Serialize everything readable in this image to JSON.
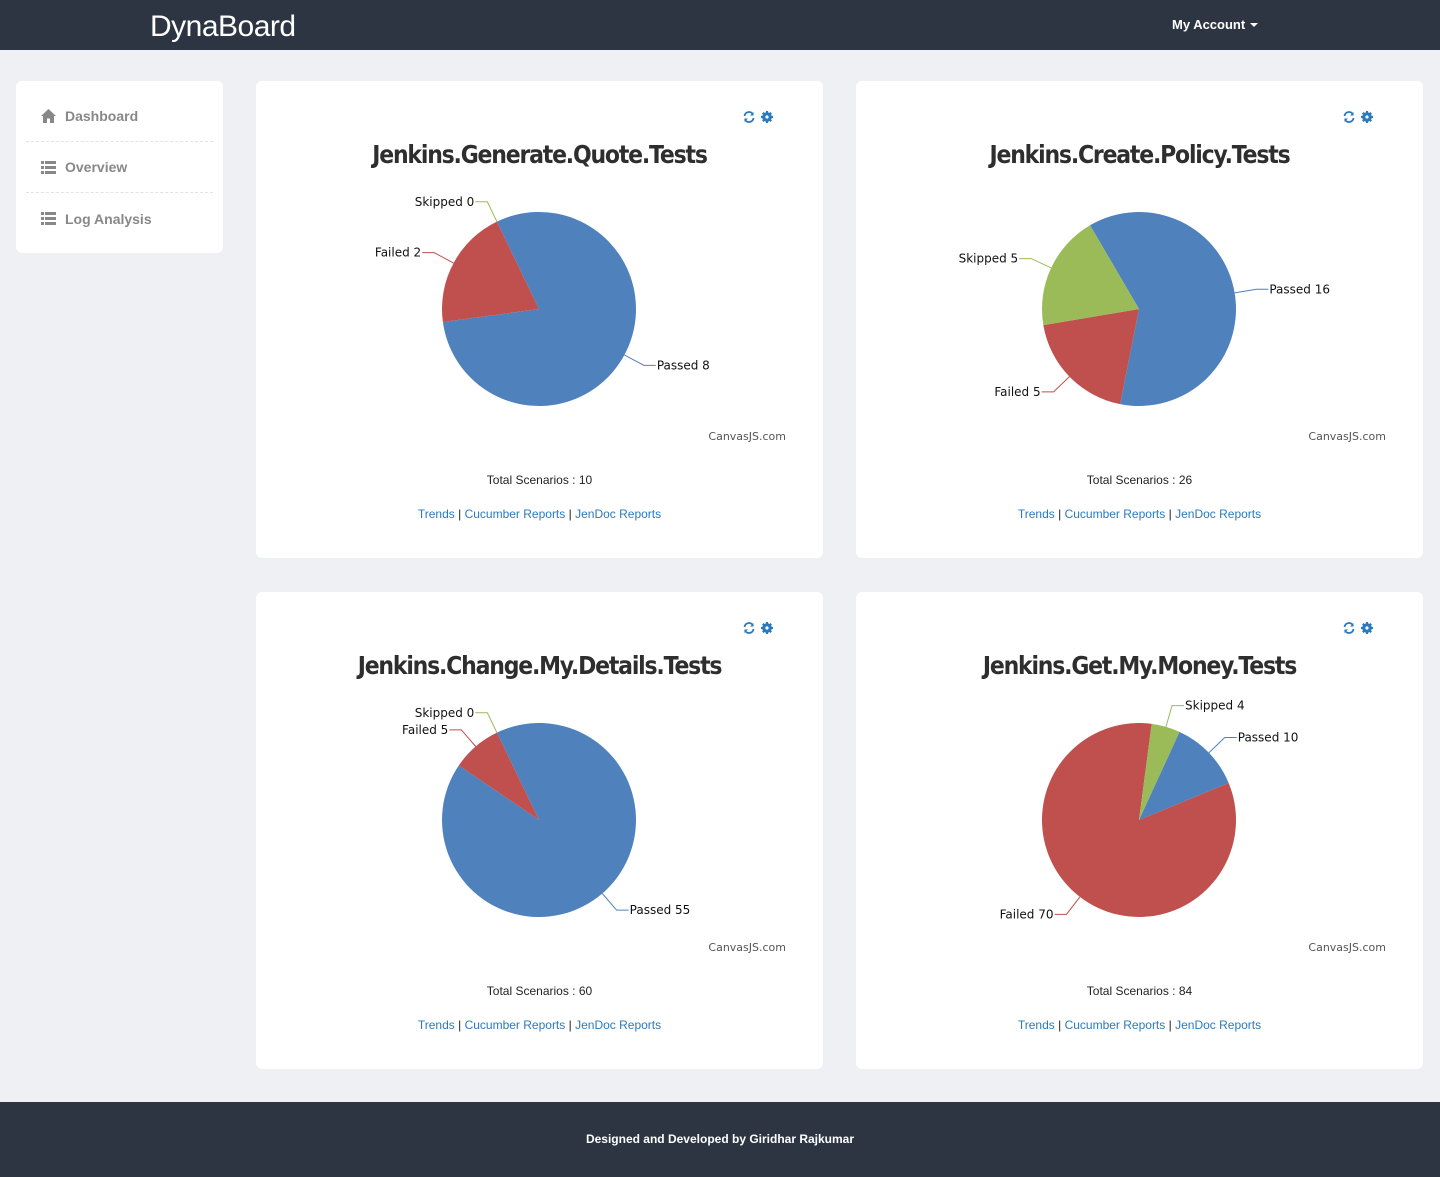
{
  "header": {
    "brand": "DynaBoard",
    "account_label": "My Account"
  },
  "sidebar": {
    "items": [
      {
        "label": "Dashboard",
        "icon": "home-icon"
      },
      {
        "label": "Overview",
        "icon": "list-icon"
      },
      {
        "label": "Log Analysis",
        "icon": "list-icon"
      }
    ]
  },
  "cards": [
    {
      "title": "Jenkins.Generate.Quote.Tests",
      "total": "Total Scenarios : 10",
      "credit": "CanvasJS.com",
      "links": {
        "trends": "Trends",
        "cucumber": "Cucumber Reports",
        "jendoc": "JenDoc Reports",
        "sep": "|"
      }
    },
    {
      "title": "Jenkins.Create.Policy.Tests",
      "total": "Total Scenarios : 26",
      "credit": "CanvasJS.com",
      "links": {
        "trends": "Trends",
        "cucumber": "Cucumber Reports",
        "jendoc": "JenDoc Reports",
        "sep": "|"
      }
    },
    {
      "title": "Jenkins.Change.My.Details.Tests",
      "total": "Total Scenarios : 60",
      "credit": "CanvasJS.com",
      "links": {
        "trends": "Trends",
        "cucumber": "Cucumber Reports",
        "jendoc": "JenDoc Reports",
        "sep": "|"
      }
    },
    {
      "title": "Jenkins.Get.My.Money.Tests",
      "total": "Total Scenarios : 84",
      "credit": "CanvasJS.com",
      "links": {
        "trends": "Trends",
        "cucumber": "Cucumber Reports",
        "jendoc": "JenDoc Reports",
        "sep": "|"
      }
    }
  ],
  "colors": {
    "passed": "#4f81bd",
    "failed": "#c0504d",
    "skipped": "#9bbb59",
    "link": "#2a7abf",
    "topbar": "#2c3541"
  },
  "chart_data": [
    {
      "type": "pie",
      "title": "Jenkins.Generate.Quote.Tests",
      "slices": [
        {
          "label": "Passed",
          "value": 8
        },
        {
          "label": "Failed",
          "value": 2
        },
        {
          "label": "Skipped",
          "value": 0
        }
      ]
    },
    {
      "type": "pie",
      "title": "Jenkins.Create.Policy.Tests",
      "slices": [
        {
          "label": "Passed",
          "value": 16
        },
        {
          "label": "Failed",
          "value": 5
        },
        {
          "label": "Skipped",
          "value": 5
        }
      ]
    },
    {
      "type": "pie",
      "title": "Jenkins.Change.My.Details.Tests",
      "slices": [
        {
          "label": "Passed",
          "value": 55
        },
        {
          "label": "Failed",
          "value": 5
        },
        {
          "label": "Skipped",
          "value": 0
        }
      ]
    },
    {
      "type": "pie",
      "title": "Jenkins.Get.My.Money.Tests",
      "slices": [
        {
          "label": "Passed",
          "value": 10
        },
        {
          "label": "Failed",
          "value": 70
        },
        {
          "label": "Skipped",
          "value": 4
        }
      ]
    }
  ],
  "footer": {
    "text": "Designed and Developed by Giridhar Rajkumar"
  }
}
